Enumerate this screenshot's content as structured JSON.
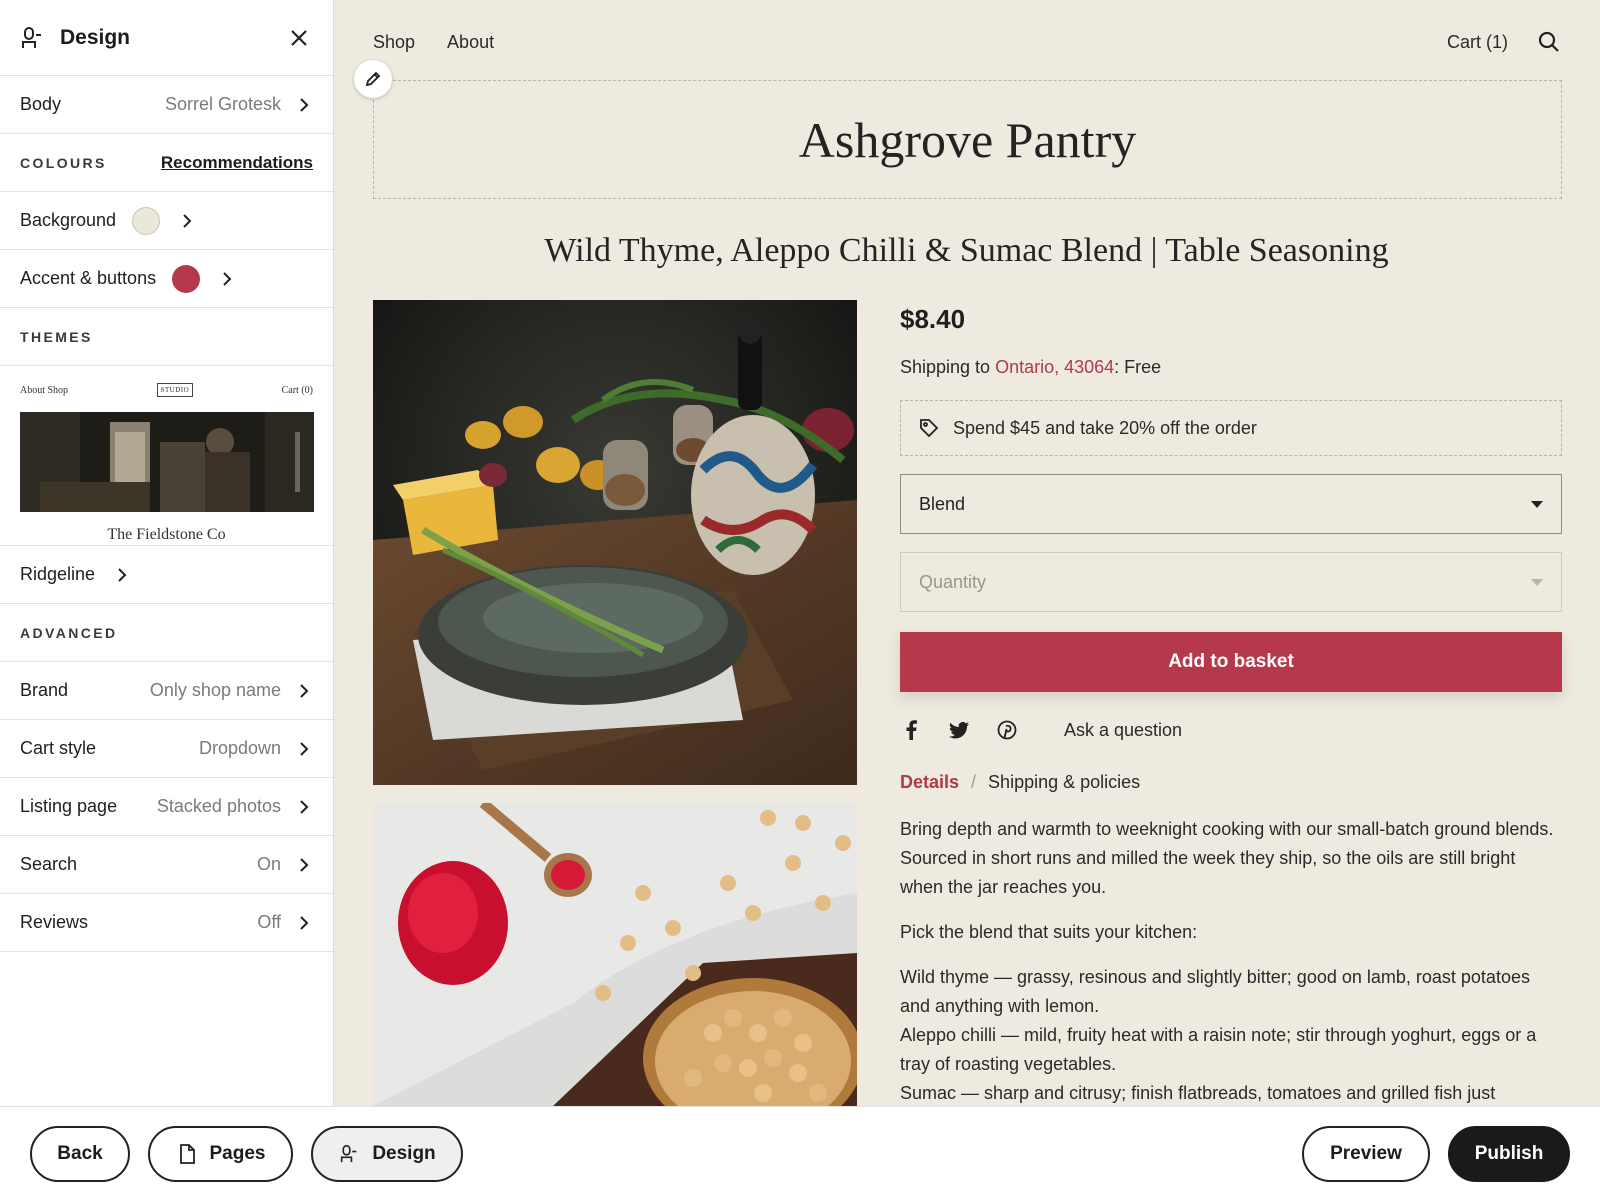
{
  "sidebar": {
    "title": "Design",
    "body_row": {
      "label": "Body",
      "value": "Sorrel Grotesk"
    },
    "colours": {
      "heading": "COLOURS",
      "recommendations": "Recommendations",
      "background": {
        "label": "Background",
        "color": "#ebe7d9"
      },
      "accent": {
        "label": "Accent & buttons",
        "color": "#b5394a"
      }
    },
    "themes": {
      "heading": "THEMES",
      "card": {
        "nav_left": "About  Shop",
        "logo": "STUDIO",
        "nav_right": "Cart (0)",
        "name": "The Fieldstone Co"
      },
      "ridgeline": "Ridgeline"
    },
    "advanced": {
      "heading": "ADVANCED",
      "rows": [
        {
          "label": "Brand",
          "value": "Only shop name"
        },
        {
          "label": "Cart style",
          "value": "Dropdown"
        },
        {
          "label": "Listing page",
          "value": "Stacked photos"
        },
        {
          "label": "Search",
          "value": "On"
        },
        {
          "label": "Reviews",
          "value": "Off"
        }
      ]
    }
  },
  "store": {
    "nav": {
      "shop": "Shop",
      "about": "About",
      "cart": "Cart (1)"
    },
    "brand": "Ashgrove Pantry",
    "product": {
      "title": "Wild Thyme, Aleppo Chilli & Sumac Blend | Table Seasoning",
      "price": "$8.40",
      "shipping_prefix": "Shipping to ",
      "shipping_location": "Ontario, 43064",
      "shipping_suffix": ": Free",
      "promo": "Spend $45 and take 20% off the order",
      "variant_select": "Blend",
      "quantity_placeholder": "Quantity",
      "add_button": "Add to basket",
      "ask": "Ask a question",
      "tab_details": "Details",
      "tab_separator": "/",
      "tab_shipping": "Shipping & policies",
      "description": [
        "Bring depth and warmth to weeknight cooking with our small-batch ground blends. Sourced in short runs and milled the week they ship, so the oils are still bright when the jar reaches you.",
        "Pick the blend that suits your kitchen:",
        "Wild thyme — grassy, resinous and slightly bitter; good on lamb, roast potatoes and anything with lemon.",
        "Aleppo chilli — mild, fruity heat with a raisin note; stir through yoghurt, eggs or a tray of roasting vegetables.",
        "Sumac — sharp and citrusy; finish flatbreads, tomatoes and grilled fish just"
      ]
    }
  },
  "bottombar": {
    "back": "Back",
    "pages": "Pages",
    "design": "Design",
    "preview": "Preview",
    "publish": "Publish"
  },
  "colors": {
    "accent": "#b5394a",
    "page_background": "#efeadf",
    "publish_button": "#1a1a1a"
  }
}
